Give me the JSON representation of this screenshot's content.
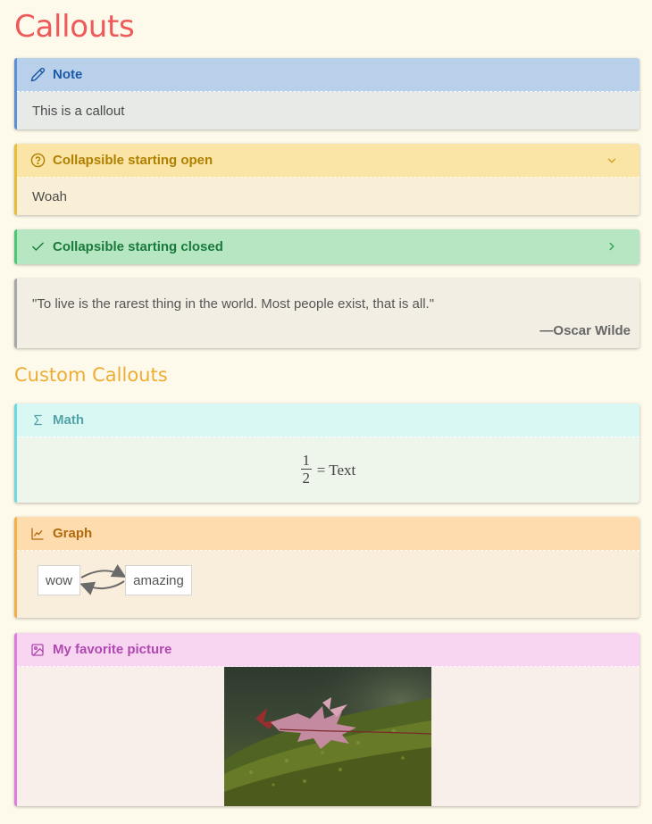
{
  "page": {
    "title": "Callouts",
    "section_title": "Custom Callouts"
  },
  "callouts": {
    "note": {
      "title": "Note",
      "body": "This is a callout",
      "icon": "pencil-icon",
      "accent": "#5b8fd6"
    },
    "open": {
      "title": "Collapsible starting open",
      "body": "Woah",
      "icon": "question-circle-icon",
      "accent": "#e8bd3a",
      "state": "expanded"
    },
    "closed": {
      "title": "Collapsible starting closed",
      "icon": "check-icon",
      "accent": "#4cc774",
      "state": "collapsed"
    },
    "quote": {
      "text": "\"To live is the rarest thing in the world. Most people exist, that is all.\"",
      "author": "—Oscar Wilde",
      "accent": "#a8a8a8"
    },
    "math": {
      "title": "Math",
      "icon": "sigma-icon",
      "numerator": "1",
      "denominator": "2",
      "rhs": "= Text",
      "accent": "#6fd9e0"
    },
    "graph": {
      "title": "Graph",
      "icon": "line-chart-icon",
      "nodes": [
        "wow",
        "amazing"
      ],
      "accent": "#f4b046"
    },
    "picture": {
      "title": "My favorite picture",
      "icon": "image-icon",
      "accent": "#e07ce0"
    }
  }
}
